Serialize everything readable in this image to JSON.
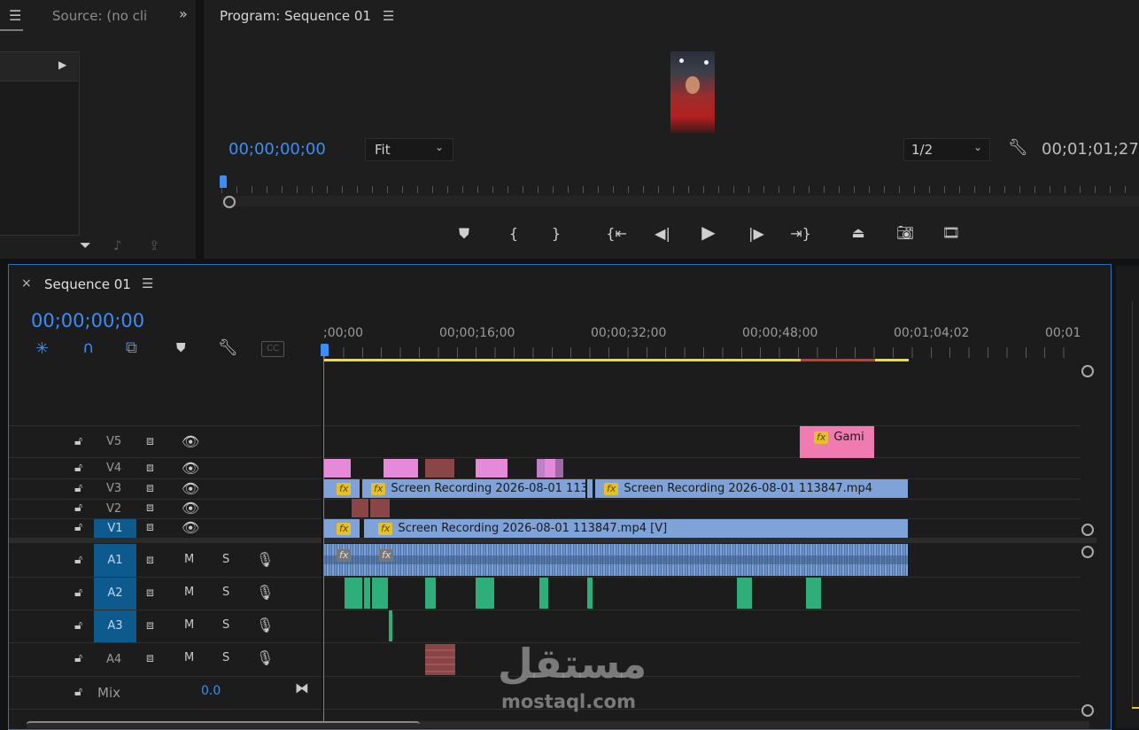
{
  "source_panel": {
    "title": "Source: (no cli"
  },
  "program_panel": {
    "title": "Program: Sequence 01",
    "current_timecode": "00;00;00;00",
    "zoom_value": "Fit",
    "resolution_value": "1/2",
    "duration_timecode": "00;01;01;27"
  },
  "sequence_panel": {
    "tab_title": "Sequence 01",
    "timecode": "00;00;00;00",
    "ruler_labels": [
      ";00;00",
      "00;00;16;00",
      "00;00;32;00",
      "00;00;48;00",
      "00;01;04;02",
      "00;01"
    ],
    "video_tracks": [
      "V5",
      "V4",
      "V3",
      "V2",
      "V1"
    ],
    "audio_tracks": [
      "A1",
      "A2",
      "A3",
      "A4"
    ],
    "mix_label": "Mix",
    "mix_value": "0.0",
    "audio_buttons": {
      "mute": "M",
      "solo": "S"
    }
  },
  "clips": {
    "v5_title": "Gami",
    "v3_clip1": "Screen Recording 2026-08-01 113",
    "v3_clip2": "Screen Recording 2026-08-01 113847.mp4",
    "v1_clip": "Screen Recording 2026-08-01 113847.mp4 [V]",
    "fx_badge": "fx"
  },
  "watermark": {
    "arabic": "مستقل",
    "latin": "mostaql.com"
  },
  "colors": {
    "accent_blue": "#3d8df5",
    "video_clip": "#7fa3d8",
    "audio_clip_green": "#2fae7c",
    "title_clip_pink": "#ef7bb0",
    "work_area_yellow": "#f0e020",
    "render_red": "#d03a2a"
  }
}
